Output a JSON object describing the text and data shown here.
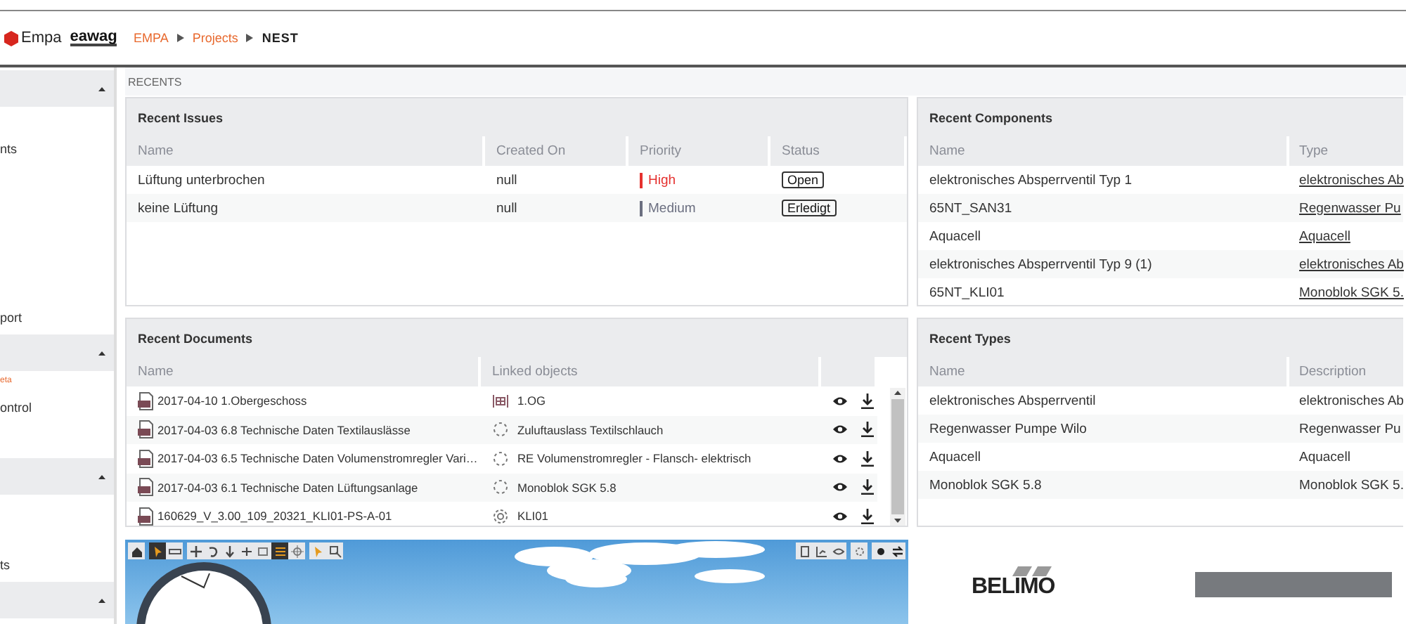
{
  "header": {
    "logos": [
      {
        "kind": "empa",
        "text": "Empa"
      },
      {
        "kind": "eawag",
        "text": "eawag"
      }
    ],
    "breadcrumb": [
      {
        "label": "EMPA",
        "current": false
      },
      {
        "label": "Projects",
        "current": false
      },
      {
        "label": "NEST",
        "current": true
      }
    ]
  },
  "sidebar": {
    "sections": [
      {
        "expanded": true,
        "items": [
          {
            "label": "nts",
            "kind": "item"
          },
          {
            "label": "port",
            "kind": "item"
          }
        ]
      },
      {
        "expanded": true,
        "items": [
          {
            "label": "eta",
            "kind": "sub"
          },
          {
            "label": "ontrol",
            "kind": "item"
          }
        ]
      },
      {
        "expanded": true,
        "items": [
          {
            "label": "ts",
            "kind": "item"
          }
        ]
      },
      {
        "expanded": true
      }
    ]
  },
  "section_title": "RECENTS",
  "recent_issues": {
    "title": "Recent Issues",
    "columns": [
      "Name",
      "Created On",
      "Priority",
      "Status"
    ],
    "rows": [
      {
        "name": "Lüftung unterbrochen",
        "created_on": "null",
        "priority": "High",
        "color": "#e5312f",
        "status": "Open"
      },
      {
        "name": "keine Lüftung",
        "created_on": "null",
        "priority": "Medium",
        "color": "#6b6f80",
        "status": "Erledigt"
      }
    ]
  },
  "recent_documents": {
    "title": "Recent Documents",
    "columns": [
      "Name",
      "Linked objects"
    ],
    "rows": [
      {
        "name": "2017-04-10 1.Obergeschoss",
        "linked_object": {
          "kind": "floor",
          "label": "1.OG"
        }
      },
      {
        "name": "2017-04-03 6.8 Technische Daten Textilauslässe",
        "linked_object": {
          "kind": "component",
          "label": "Zuluftauslass Textilschlauch"
        }
      },
      {
        "name": "2017-04-03 6.5 Technische Daten Volumenstromregler Vari…",
        "linked_object": {
          "kind": "component",
          "label": "RE Volumenstromregler - Flansch- elektrisch"
        }
      },
      {
        "name": "2017-04-03 6.1 Technische Daten Lüftungsanlage",
        "linked_object": {
          "kind": "component",
          "label": "Monoblok SGK 5.8"
        }
      },
      {
        "name": "160629_V_3.00_109_20321_KLI01-PS-A-01",
        "linked_object": {
          "kind": "system",
          "label": "KLI01"
        }
      }
    ]
  },
  "recent_components": {
    "title": "Recent Components",
    "columns": [
      "Name",
      "Type"
    ],
    "rows": [
      {
        "name": "elektronisches Absperrventil Typ 1",
        "type": "elektronisches Ab"
      },
      {
        "name": "65NT_SAN31",
        "type": "Regenwasser Pu"
      },
      {
        "name": "Aquacell",
        "type": "Aquacell"
      },
      {
        "name": "elektronisches Absperrventil Typ 9 (1)",
        "type": "elektronisches Ab"
      },
      {
        "name": "65NT_KLI01",
        "type": "Monoblok SGK 5."
      }
    ]
  },
  "recent_types": {
    "title": "Recent Types",
    "columns": [
      "Name",
      "Description"
    ],
    "rows": [
      {
        "name": "elektronisches Absperrventil",
        "description": "elektronisches Ab"
      },
      {
        "name": "Regenwasser Pumpe Wilo",
        "description": "Regenwasser Pu"
      },
      {
        "name": "Aquacell",
        "description": "Aquacell"
      },
      {
        "name": "Monoblok SGK 5.8",
        "description": "Monoblok SGK 5."
      }
    ]
  },
  "viewer": {
    "left_groups": [
      [
        {
          "kind": "home",
          "selected": false
        }
      ],
      [
        {
          "kind": "cursor",
          "selected": true
        },
        {
          "kind": "ruler",
          "selected": false
        }
      ],
      [
        {
          "kind": "move",
          "selected": false
        },
        {
          "kind": "rotate",
          "selected": false
        },
        {
          "kind": "down",
          "selected": false
        },
        {
          "kind": "plus",
          "selected": false
        },
        {
          "kind": "square",
          "selected": false
        },
        {
          "kind": "grid",
          "selected": true
        },
        {
          "kind": "target",
          "selected": false
        }
      ],
      [
        {
          "kind": "cursor",
          "selected": false
        },
        {
          "kind": "zoombox",
          "selected": false
        }
      ]
    ],
    "right_groups": [
      [
        {
          "kind": "clipboard",
          "selected": false
        },
        {
          "kind": "chart",
          "selected": false
        },
        {
          "kind": "eye",
          "selected": false
        }
      ],
      [
        {
          "kind": "gear",
          "selected": false
        }
      ],
      [
        {
          "kind": "circle",
          "selected": false
        },
        {
          "kind": "swap",
          "selected": false
        }
      ]
    ]
  },
  "partner_logo": {
    "text": "BELIMO"
  }
}
